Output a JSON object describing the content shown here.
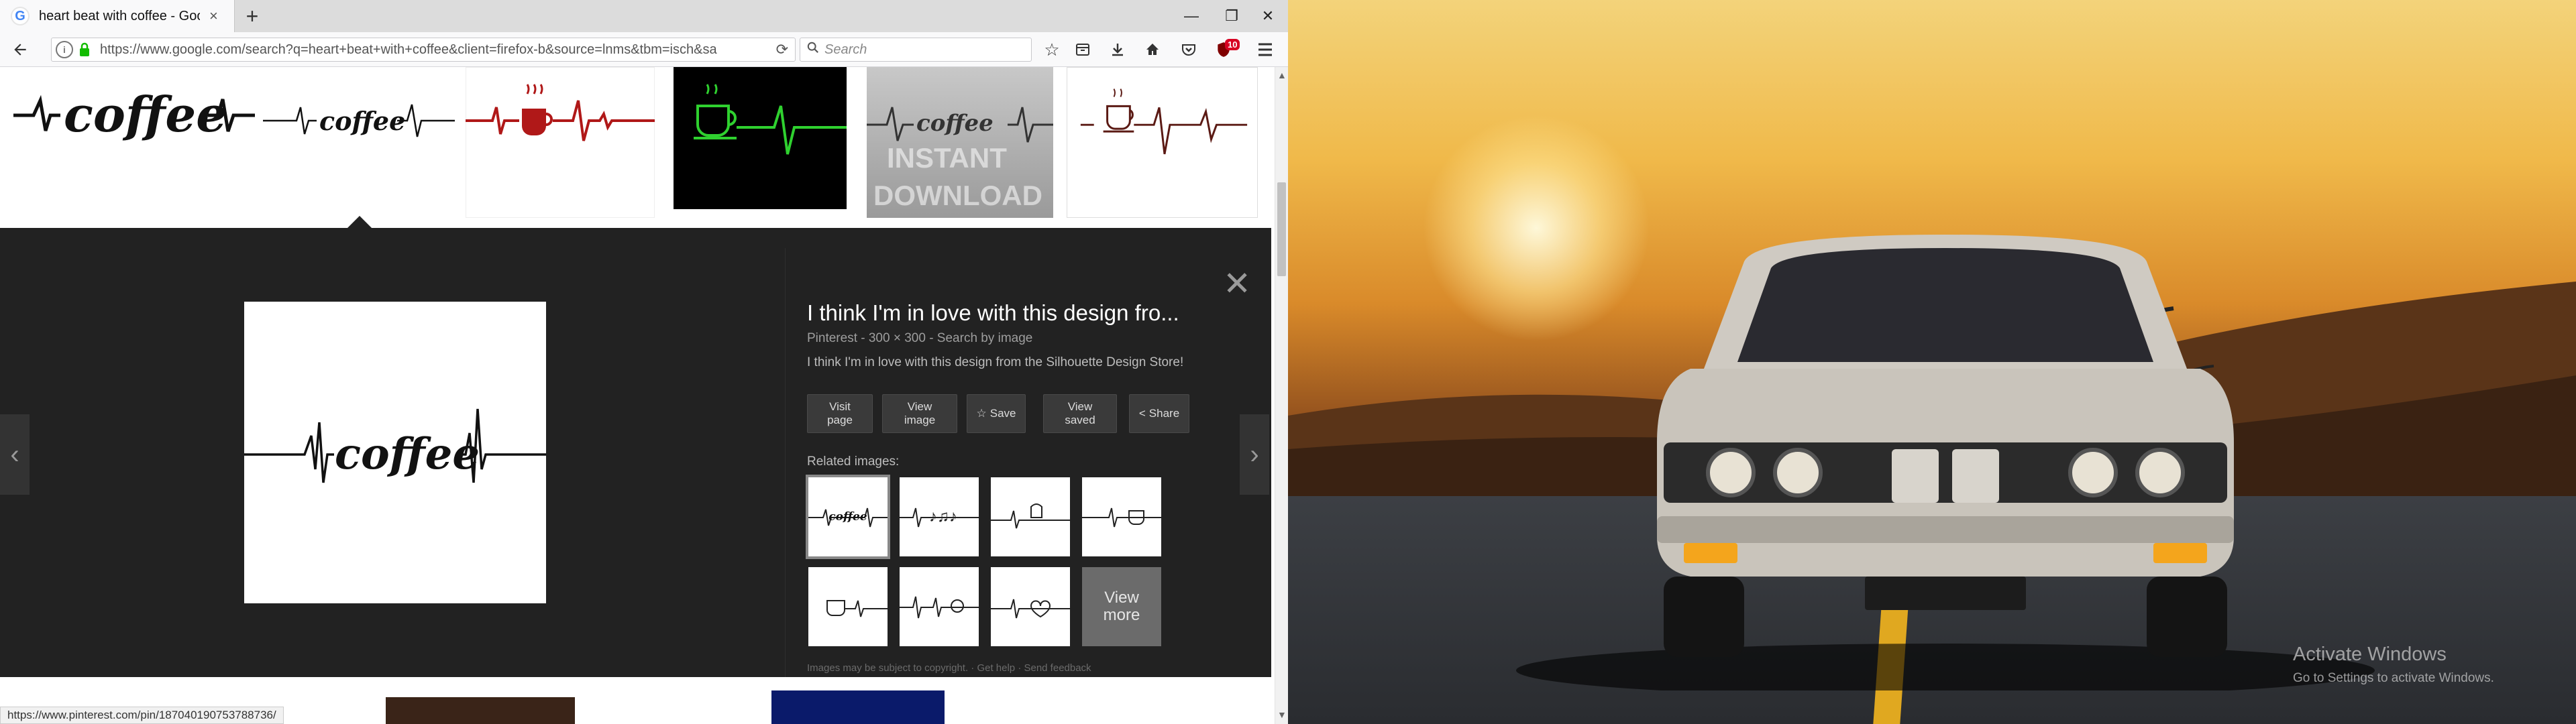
{
  "browser": {
    "tab": {
      "title": "heart beat with coffee - Goo",
      "close": "×"
    },
    "newtab": "+",
    "window_controls": {
      "minimize": "—",
      "maximize": "❐",
      "close": "✕"
    },
    "url": "https://www.google.com/search?q=heart+beat+with+coffee&client=firefox-b&source=lnms&tbm=isch&sa",
    "search_placeholder": "Search",
    "badge_count": "10"
  },
  "thumbs": {
    "coffee_word": "coffee"
  },
  "detail": {
    "title": "I think I'm in love with this design fro...",
    "meta": "Pinterest - 300 × 300 - Search by image",
    "description": "I think I'm in love with this design from the Silhouette Design Store!",
    "preview_word": "coffee",
    "buttons": {
      "visit": "Visit\npage",
      "view_image": "View\nimage",
      "save": "Save",
      "view_saved": "View\nsaved",
      "share": "Share"
    },
    "related_label": "Related images:",
    "view_more": "View\nmore",
    "footer": "Images may be subject to copyright.  ·  Get help  ·  Send feedback",
    "close": "✕",
    "nav_prev": "‹",
    "nav_next": "›"
  },
  "status_url": "https://www.pinterest.com/pin/187040190753788736/",
  "watermark": {
    "title": "Activate Windows",
    "subtitle": "Go to Settings to activate Windows."
  },
  "icons": {
    "back": "back-arrow-icon",
    "info": "info-icon",
    "lock": "lock-icon",
    "reload": "reload-icon",
    "search": "search-icon",
    "bookmark": "star-icon",
    "library": "library-icon",
    "downloads": "download-icon",
    "home": "home-icon",
    "pocket": "pocket-icon",
    "ublock": "ublock-icon",
    "menu": "hamburger-menu-icon"
  },
  "colors": {
    "panel_bg": "#222222",
    "ekg_red": "#b01818",
    "ekg_green": "#2fd12f",
    "lock_green": "#12bc00"
  }
}
